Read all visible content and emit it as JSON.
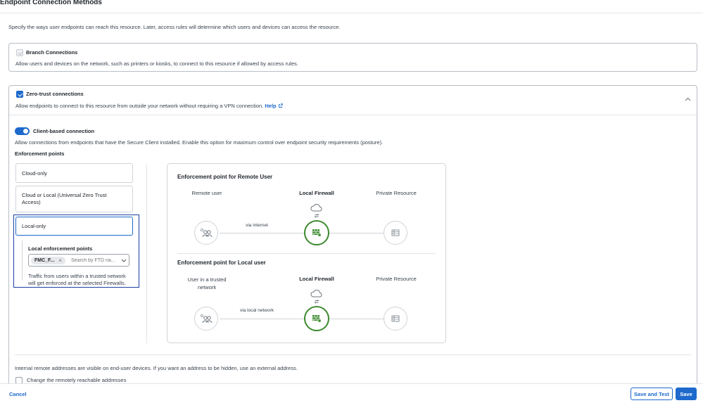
{
  "page": {
    "title": "Endpoint Connection Methods",
    "description": "Specify the ways user endpoints can reach this resource. Later, access rules will determine which users and devices can access the resource."
  },
  "branch": {
    "label": "Branch Connections",
    "description": "Allow users and devices on the network, such as printers or kiosks, to connect to this resource if allowed by access rules.",
    "checked": true,
    "disabled": true
  },
  "zero_trust": {
    "label": "Zero-trust connections",
    "description": "Allow endpoints to connect to this resource from outside your network without requiring a VPN connection.",
    "help_label": "Help",
    "checked": true,
    "client_based": {
      "label": "Client-based connection",
      "enabled": true,
      "description": "Allow connections from endpoints that have the Secure Client installed. Enable this option for maximum control over endpoint security requirements (posture)."
    },
    "enforcement_points": {
      "heading": "Enforcement points",
      "options": [
        {
          "label": "Cloud-only"
        },
        {
          "label_line1": "Cloud or Local (Universal Zero Trust",
          "label_line2": "Access)"
        },
        {
          "label": "Local-only"
        }
      ],
      "selected": "Local-only",
      "local": {
        "heading": "Local enforcement points",
        "chip": "FMC_F...",
        "placeholder": "Search by FTD na...",
        "note_line1": "Traffic from users within a trusted network",
        "note_line2": "will get enforced at the selected Firewalls."
      }
    }
  },
  "diagram": {
    "remote": {
      "title": "Enforcement point for Remote User",
      "left": "Remote user",
      "middle": "Local Firewall",
      "right": "Private Resource",
      "path_label": "via internet"
    },
    "local": {
      "title": "Enforcement point for Local user",
      "left_line1": "User in a trusted",
      "left_line2": "network",
      "middle": "Local Firewall",
      "right": "Private Resource",
      "path_label": "via local network"
    },
    "colors": {
      "firewall": "#3c8a2e",
      "accent": "#1d69cc"
    }
  },
  "addresses": {
    "note": "Internal remote addresses are visible on end-user devices. If you want an address to be hidden, use an external address.",
    "checkbox_label": "Change the remotely reachable addresses",
    "checked": false
  },
  "footer": {
    "cancel": "Cancel",
    "save_and_test": "Save and Test",
    "save": "Save"
  }
}
